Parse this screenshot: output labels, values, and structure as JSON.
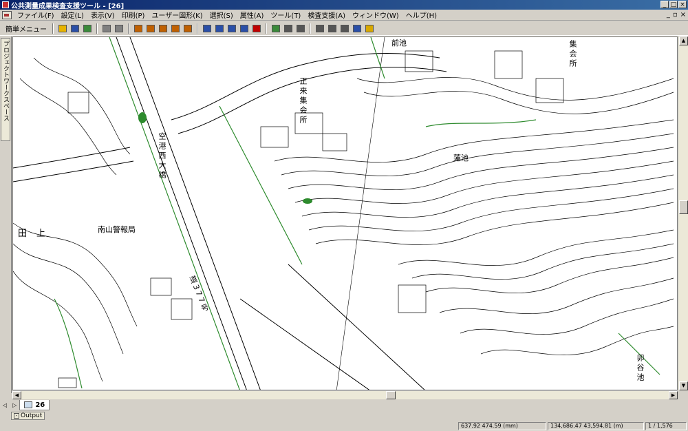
{
  "window": {
    "title": "公共測量成果検査支援ツール - [26]",
    "mdi_controls": [
      "_",
      "▫",
      "×"
    ]
  },
  "menu": {
    "items": [
      {
        "label": "ファイル(F)"
      },
      {
        "label": "設定(L)"
      },
      {
        "label": "表示(V)"
      },
      {
        "label": "印刷(P)"
      },
      {
        "label": "ユーザー図形(K)"
      },
      {
        "label": "選択(S)"
      },
      {
        "label": "属性(A)"
      },
      {
        "label": "ツール(T)"
      },
      {
        "label": "検査支援(A)"
      },
      {
        "label": "ウィンドウ(W)"
      },
      {
        "label": "ヘルプ(H)"
      }
    ]
  },
  "toolbar": {
    "quick_menu_label": "簡単メニュー",
    "buttons": [
      {
        "icon": "open-folder-icon",
        "color": "#e8b400"
      },
      {
        "icon": "save-icon",
        "color": "#2a4fa8"
      },
      {
        "icon": "refresh-icon",
        "color": "#3a8a3a"
      },
      {
        "icon": "print-icon",
        "color": "#808080"
      },
      {
        "icon": "print-preview-icon",
        "color": "#808080"
      },
      {
        "icon": "point-tool-icon",
        "color": "#c06000"
      },
      {
        "icon": "line-tool-icon",
        "color": "#c06000"
      },
      {
        "icon": "polygon-tool-icon",
        "color": "#c06000"
      },
      {
        "icon": "text-tool-icon",
        "color": "#c06000"
      },
      {
        "icon": "symbol-tool-icon",
        "color": "#c06000"
      },
      {
        "icon": "select-rect-icon",
        "color": "#2a4fa8"
      },
      {
        "icon": "zoom-in-icon",
        "color": "#2a4fa8"
      },
      {
        "icon": "zoom-out-icon",
        "color": "#2a4fa8"
      },
      {
        "icon": "zoom-fit-icon",
        "color": "#2a4fa8"
      },
      {
        "icon": "pan-icon",
        "color": "#c00000"
      },
      {
        "icon": "layer-icon",
        "color": "#3a8a3a"
      },
      {
        "icon": "attribute-icon",
        "color": "#555555"
      },
      {
        "icon": "table-icon",
        "color": "#555555"
      },
      {
        "icon": "measure-icon",
        "color": "#555555"
      },
      {
        "icon": "image-icon",
        "color": "#555555"
      },
      {
        "icon": "photo-icon",
        "color": "#555555"
      },
      {
        "icon": "search-icon",
        "color": "#2a4fa8"
      },
      {
        "icon": "warning-icon",
        "color": "#d8a800"
      }
    ]
  },
  "side_panel": {
    "tab_label": "プロジェクトワークスペース"
  },
  "map": {
    "labels": [
      {
        "text": "前池"
      },
      {
        "text": "集会所"
      },
      {
        "text": "正来集会所"
      },
      {
        "text": "蓮池"
      },
      {
        "text": "空港西大橋"
      },
      {
        "text": "南山警報局"
      },
      {
        "text": "田上"
      },
      {
        "text": "道377号"
      },
      {
        "text": "卯谷池"
      }
    ],
    "line_color": "#000000",
    "vegetation_color": "#2e8b2e"
  },
  "tabs": {
    "nav_prev": "◁",
    "nav_next": "▷",
    "active_tab": "26"
  },
  "output": {
    "label": "Output",
    "toggle": "-"
  },
  "status": {
    "cursor_mm": "637.92  474.59  (mm)",
    "cursor_m": "134,686.47  43,594.81  (m)",
    "scale": "1 / 1,576"
  }
}
